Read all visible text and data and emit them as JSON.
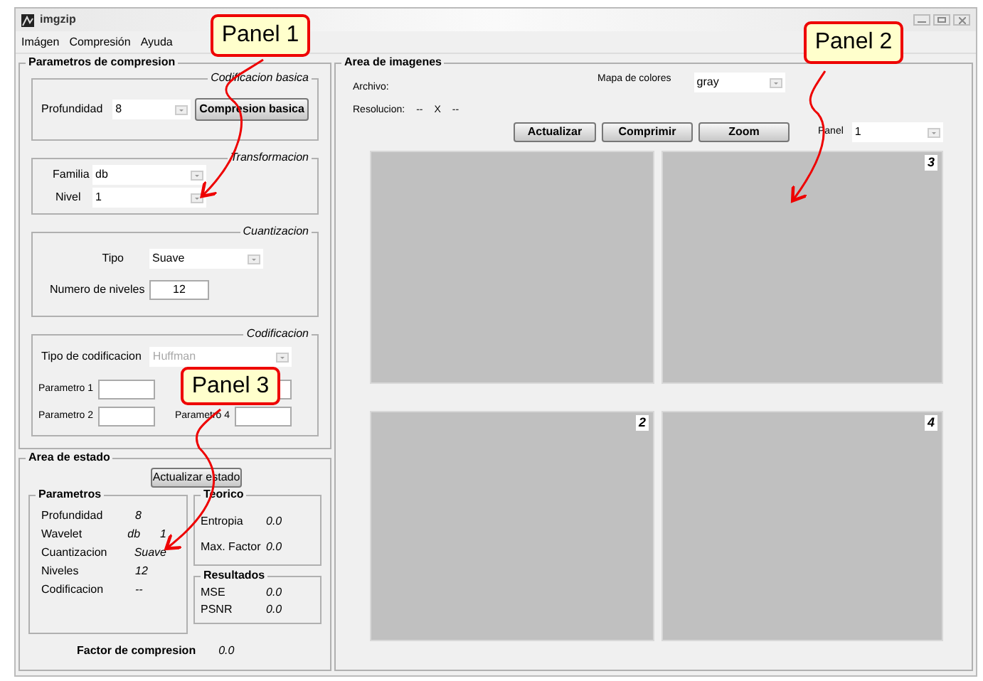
{
  "window": {
    "title": "imgzip"
  },
  "menu": [
    "Imágen",
    "Compresión",
    "Ayuda"
  ],
  "parametros": {
    "title": "Parametros de compresion",
    "codificacion_basica": {
      "title": "Codificacion basica",
      "profundidad_label": "Profundidad",
      "profundidad_value": "8",
      "button": "Compresion basica"
    },
    "transformacion": {
      "title": "Transformacion",
      "familia_label": "Familia",
      "familia_value": "db",
      "nivel_label": "Nivel",
      "nivel_value": "1"
    },
    "cuantizacion": {
      "title": "Cuantizacion",
      "tipo_label": "Tipo",
      "tipo_value": "Suave",
      "niveles_label": "Numero de niveles",
      "niveles_value": "12"
    },
    "codificacion": {
      "title": "Codificacion",
      "tipo_label": "Tipo de codificacion",
      "tipo_value": "Huffman",
      "disabled": true,
      "params": [
        {
          "kind": "labeled",
          "label": "Parametro 1"
        },
        {
          "kind": "unlabeled"
        },
        {
          "kind": "labeled",
          "label": "Parametro 2"
        },
        {
          "kind": "labeled",
          "label": "Parametro 4"
        }
      ]
    }
  },
  "estado": {
    "title": "Area de estado",
    "button": "Actualizar estado",
    "parametros": {
      "title": "Parametros",
      "rows": [
        {
          "label": "Profundidad",
          "values": [
            "8"
          ]
        },
        {
          "label": "Wavelet",
          "values": [
            "db",
            "1"
          ]
        },
        {
          "label": "Cuantizacion",
          "values": [
            "Suave"
          ]
        },
        {
          "label": "Niveles",
          "values": [
            "12"
          ]
        },
        {
          "label": "Codificacion",
          "values": [
            "--"
          ]
        }
      ]
    },
    "teorico": {
      "title": "Teorico",
      "rows": [
        {
          "label": "Entropia",
          "value": "0.0"
        },
        {
          "label": "Max. Factor",
          "value": "0.0"
        }
      ]
    },
    "resultados": {
      "title": "Resultados",
      "rows": [
        {
          "label": "MSE",
          "value": "0.0"
        },
        {
          "label": "PSNR",
          "value": "0.0"
        }
      ]
    },
    "factor_label": "Factor de compresion",
    "factor_value": "0.0"
  },
  "imagenes": {
    "title": "Area de imagenes",
    "archivo_label": "Archivo:",
    "resolucion_label": "Resolucion:",
    "resolucion_values": [
      "--",
      "X",
      "--"
    ],
    "mapa_label": "Mapa de colores",
    "mapa_value": "gray",
    "buttons": [
      "Actualizar",
      "Comprimir",
      "Zoom"
    ],
    "panel_label": "Panel",
    "panel_value": "1",
    "axes": [
      {
        "kind": "blank"
      },
      {
        "kind": "numbered",
        "number": "3"
      },
      {
        "kind": "numbered",
        "number": "2"
      },
      {
        "kind": "numbered",
        "number": "4"
      }
    ]
  },
  "callouts": [
    "Panel 1",
    "Panel 2",
    "Panel 3"
  ]
}
